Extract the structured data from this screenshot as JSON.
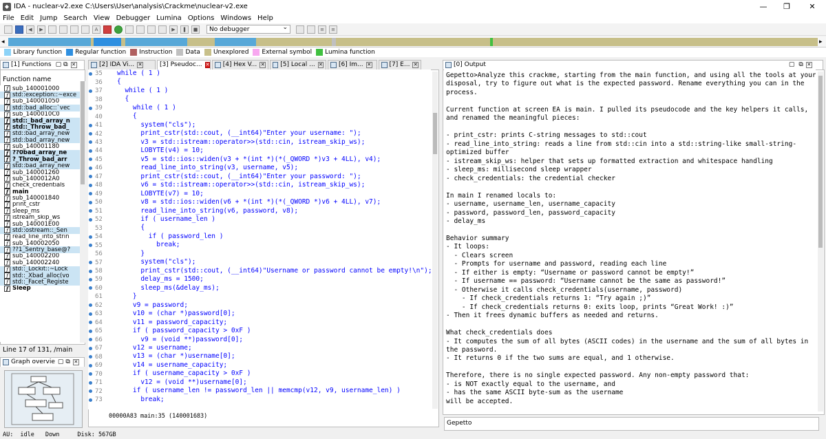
{
  "window": {
    "title": "IDA - nuclear-v2.exe C:\\Users\\User\\analysis\\Crackme\\nuclear-v2.exe",
    "icon": "ida-icon"
  },
  "menu": [
    "File",
    "Edit",
    "Jump",
    "Search",
    "View",
    "Debugger",
    "Lumina",
    "Options",
    "Windows",
    "Help"
  ],
  "toolbar": {
    "debugger_select": "No debugger"
  },
  "legend": [
    {
      "label": "Library function",
      "color": "#8cd3f8"
    },
    {
      "label": "Regular function",
      "color": "#2e8fe0"
    },
    {
      "label": "Instruction",
      "color": "#b06060"
    },
    {
      "label": "Data",
      "color": "#c0c0c0"
    },
    {
      "label": "Unexplored",
      "color": "#c8c08a"
    },
    {
      "label": "External symbol",
      "color": "#f8a8f0"
    },
    {
      "label": "Lumina function",
      "color": "#40c040"
    }
  ],
  "tabs": {
    "functions": "[1] Functions",
    "idaview": "[2] IDA Vi...",
    "pseudo": "[3] Pseudoc...",
    "hex": "[4] Hex V...",
    "local": "[5] Local ...",
    "imports": "[6] Im...",
    "exports": "[7] E...",
    "output": "[0] Output",
    "graph": "Graph overvie"
  },
  "functions": {
    "header": "Function name",
    "items": [
      {
        "name": "sub_140001000",
        "kind": "regular"
      },
      {
        "name": "std::exception::~exce",
        "kind": "lib"
      },
      {
        "name": "sub_140001050",
        "kind": "regular"
      },
      {
        "name": "std::bad_alloc::`vec",
        "kind": "lib"
      },
      {
        "name": "sub_1400010C0",
        "kind": "regular"
      },
      {
        "name": "std::_bad_array_n",
        "kind": "lib-bold"
      },
      {
        "name": "std::_Throw_bad_",
        "kind": "lib-bold"
      },
      {
        "name": "std::bad_array_new",
        "kind": "lib"
      },
      {
        "name": "std::bad_array_new",
        "kind": "lib"
      },
      {
        "name": "sub_140001180",
        "kind": "regular"
      },
      {
        "name": "??0bad_array_ne",
        "kind": "lib-bold"
      },
      {
        "name": "?_Throw_bad_arr",
        "kind": "lib-bold"
      },
      {
        "name": "std::bad_array_new",
        "kind": "lib"
      },
      {
        "name": "sub_140001260",
        "kind": "regular"
      },
      {
        "name": "sub_1400012A0",
        "kind": "regular"
      },
      {
        "name": "check_credentials",
        "kind": "regular"
      },
      {
        "name": "main",
        "kind": "selected"
      },
      {
        "name": "sub_140001840",
        "kind": "regular"
      },
      {
        "name": "print_cstr",
        "kind": "regular"
      },
      {
        "name": "sleep_ms",
        "kind": "regular"
      },
      {
        "name": "istream_skip_ws",
        "kind": "regular"
      },
      {
        "name": "sub_140001E00",
        "kind": "regular"
      },
      {
        "name": "std::ostream::_Sen",
        "kind": "lib"
      },
      {
        "name": "read_line_into_strin",
        "kind": "regular"
      },
      {
        "name": "sub_140002050",
        "kind": "regular"
      },
      {
        "name": "??1_Sentry_base@?",
        "kind": "lib"
      },
      {
        "name": "sub_140002200",
        "kind": "regular"
      },
      {
        "name": "sub_140002240",
        "kind": "regular"
      },
      {
        "name": "std::_Lockit::~Lock",
        "kind": "lib"
      },
      {
        "name": "std::_Xbad_alloc(vo",
        "kind": "lib"
      },
      {
        "name": "std::_Facet_Registe",
        "kind": "lib"
      },
      {
        "name": "Sleep",
        "kind": "bold"
      }
    ],
    "line_info": "Line 17 of 131, /main"
  },
  "code": {
    "lines": [
      {
        "n": "35",
        "dot": true,
        "text": "while ( 1 )"
      },
      {
        "n": "36",
        "dot": false,
        "text": "{"
      },
      {
        "n": "37",
        "dot": true,
        "text": "  while ( 1 )"
      },
      {
        "n": "38",
        "dot": false,
        "text": "  {"
      },
      {
        "n": "39",
        "dot": true,
        "text": "    while ( 1 )"
      },
      {
        "n": "40",
        "dot": false,
        "text": "    {"
      },
      {
        "n": "41",
        "dot": true,
        "text": "      system(\"cls\");"
      },
      {
        "n": "42",
        "dot": true,
        "text": "      print_cstr(std::cout, (__int64)\"Enter your username: \");"
      },
      {
        "n": "43",
        "dot": true,
        "text": "      v3 = std::istream::operator>>(std::cin, istream_skip_ws);"
      },
      {
        "n": "44",
        "dot": true,
        "text": "      LOBYTE(v4) = 10;"
      },
      {
        "n": "45",
        "dot": true,
        "text": "      v5 = std::ios::widen(v3 + *(int *)(*(_QWORD *)v3 + 4LL), v4);"
      },
      {
        "n": "46",
        "dot": true,
        "text": "      read_line_into_string(v3, username, v5);"
      },
      {
        "n": "47",
        "dot": true,
        "text": "      print_cstr(std::cout, (__int64)\"Enter your password: \");"
      },
      {
        "n": "48",
        "dot": true,
        "text": "      v6 = std::istream::operator>>(std::cin, istream_skip_ws);"
      },
      {
        "n": "49",
        "dot": true,
        "text": "      LOBYTE(v7) = 10;"
      },
      {
        "n": "50",
        "dot": true,
        "text": "      v8 = std::ios::widen(v6 + *(int *)(*(_QWORD *)v6 + 4LL), v7);"
      },
      {
        "n": "51",
        "dot": true,
        "text": "      read_line_into_string(v6, password, v8);"
      },
      {
        "n": "52",
        "dot": true,
        "text": "      if ( username_len )"
      },
      {
        "n": "53",
        "dot": false,
        "text": "      {"
      },
      {
        "n": "54",
        "dot": true,
        "text": "        if ( password_len )"
      },
      {
        "n": "55",
        "dot": true,
        "text": "          break;"
      },
      {
        "n": "56",
        "dot": false,
        "text": "      }"
      },
      {
        "n": "57",
        "dot": true,
        "text": "      system(\"cls\");"
      },
      {
        "n": "58",
        "dot": true,
        "text": "      print_cstr(std::cout, (__int64)\"Username or password cannot be empty!\\n\");"
      },
      {
        "n": "59",
        "dot": true,
        "text": "      delay_ms = 1500;"
      },
      {
        "n": "60",
        "dot": true,
        "text": "      sleep_ms(&delay_ms);"
      },
      {
        "n": "61",
        "dot": false,
        "text": "    }"
      },
      {
        "n": "62",
        "dot": true,
        "text": "    v9 = password;"
      },
      {
        "n": "63",
        "dot": true,
        "text": "    v10 = (char *)password[0];"
      },
      {
        "n": "64",
        "dot": true,
        "text": "    v11 = password_capacity;"
      },
      {
        "n": "65",
        "dot": true,
        "text": "    if ( password_capacity > 0xF )"
      },
      {
        "n": "66",
        "dot": true,
        "text": "      v9 = (void **)password[0];"
      },
      {
        "n": "67",
        "dot": true,
        "text": "    v12 = username;"
      },
      {
        "n": "68",
        "dot": true,
        "text": "    v13 = (char *)username[0];"
      },
      {
        "n": "69",
        "dot": true,
        "text": "    v14 = username_capacity;"
      },
      {
        "n": "70",
        "dot": true,
        "text": "    if ( username_capacity > 0xF )"
      },
      {
        "n": "71",
        "dot": true,
        "text": "      v12 = (void **)username[0];"
      },
      {
        "n": "72",
        "dot": true,
        "text": "    if ( username_len != password_len || memcmp(v12, v9, username_len) )"
      },
      {
        "n": "73",
        "dot": true,
        "text": "      break;"
      }
    ],
    "status": "00000A83 main:35 (140001683)"
  },
  "output": {
    "lines": [
      "Gepetto>Analyze this crackme, starting from the main function, and using all the tools at your",
      "disposal, try to figure out what is the expected password. Rename everything you can in the",
      "process.",
      "",
      "Current function at screen EA is main. I pulled its pseudocode and the key helpers it calls,",
      "and renamed the meaningful pieces:",
      "",
      "- print_cstr: prints C-string messages to std::cout",
      "- read_line_into_string: reads a line from std::cin into a std::string-like small-string-",
      "optimized buffer",
      "- istream_skip_ws: helper that sets up formatted extraction and whitespace handling",
      "- sleep_ms: millisecond sleep wrapper",
      "- check_credentials: the credential checker",
      "",
      "In main I renamed locals to:",
      "- username, username_len, username_capacity",
      "- password, password_len, password_capacity",
      "- delay_ms",
      "",
      "Behavior summary",
      "- It loops:",
      "  - Clears screen",
      "  - Prompts for username and password, reading each line",
      "  - If either is empty: “Username or password cannot be empty!”",
      "  - If username == password: “Username cannot be the same as password!”",
      "  - Otherwise it calls check_credentials(username, password)",
      "    - If check_credentials returns 1: “Try again ;)”",
      "    - If check_credentials returns 0: exits loop, prints “Great Work! :)”",
      "- Then it frees dynamic buffers as needed and returns.",
      "",
      "What check_credentials does",
      "- It computes the sum of all bytes (ASCII codes) in the username and the sum of all bytes in",
      "the password.",
      "- It returns 0 if the two sums are equal, and 1 otherwise.",
      "",
      "Therefore, there is no single expected password. Any non-empty password that:",
      "- is NOT exactly equal to the username, and",
      "- has the same ASCII byte-sum as the username",
      "will be accepted."
    ],
    "input_label": "Gepetto"
  },
  "statusbar": {
    "au": "AU:",
    "state": "idle",
    "dir": "Down",
    "disk": "Disk: 567GB"
  }
}
